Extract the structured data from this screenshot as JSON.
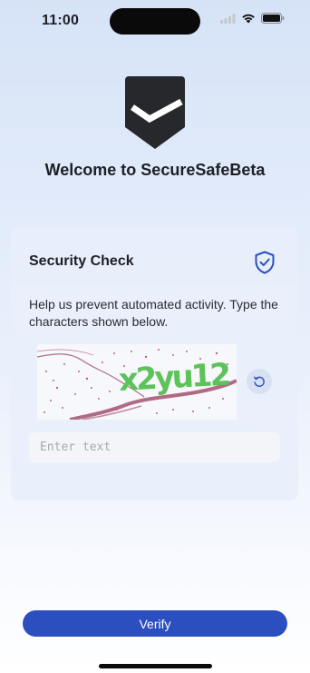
{
  "status_bar": {
    "time": "11:00",
    "icons": [
      "signal-icon",
      "wifi-icon",
      "battery-icon"
    ]
  },
  "header": {
    "logo_icon": "shield-check-logo",
    "title": "Welcome to SecureSafeBeta"
  },
  "security_card": {
    "title": "Security Check",
    "title_icon": "shield-check-icon",
    "description": "Help us prevent automated activity. Type the characters shown below.",
    "captcha_text": "x2yu12",
    "refresh_icon": "refresh-icon",
    "input": {
      "value": "",
      "placeholder": "Enter text"
    }
  },
  "actions": {
    "verify_label": "Verify"
  },
  "colors": {
    "accent": "#2c4fbf",
    "logo": "#26282c",
    "captcha_text": "#5dc25a",
    "captcha_noise": "#b06a85"
  }
}
